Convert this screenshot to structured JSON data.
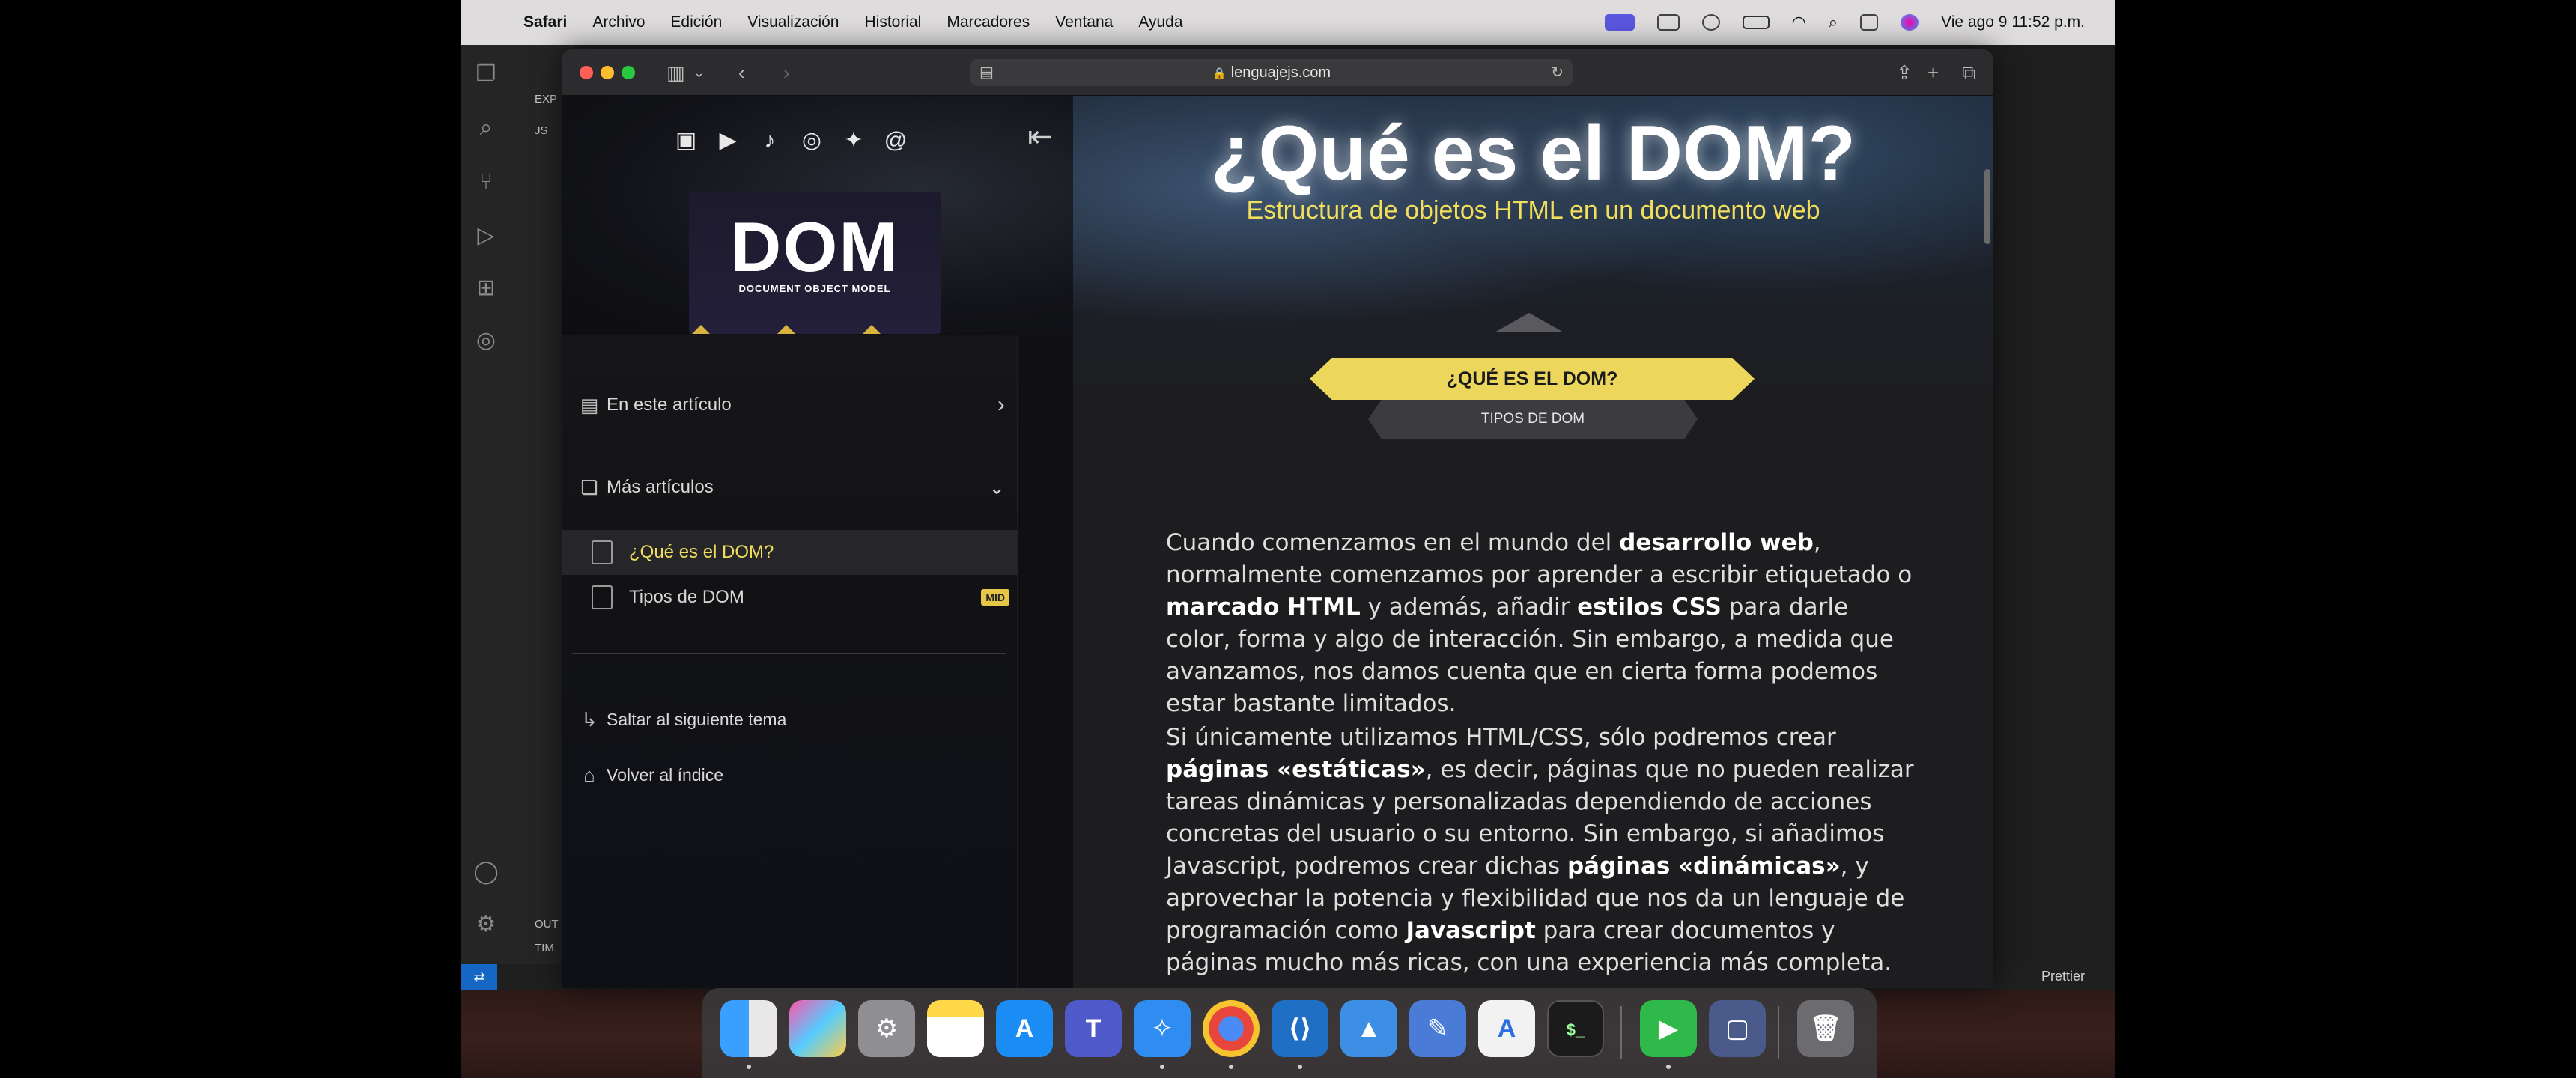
{
  "menubar": {
    "app": "Safari",
    "items": [
      "Archivo",
      "Edición",
      "Visualización",
      "Historial",
      "Marcadores",
      "Ventana",
      "Ayuda"
    ],
    "clock": "Vie ago 9  11:52 p.m."
  },
  "browser": {
    "url": "lenguajejs.com"
  },
  "sidebar": {
    "cover_title": "DOM",
    "cover_subtitle": "DOCUMENT OBJECT MODEL",
    "in_article": "En este artículo",
    "more_articles": "Más artículos",
    "articles": [
      {
        "label": "¿Qué es el DOM?",
        "active": true
      },
      {
        "label": "Tipos de DOM",
        "badge": "MID"
      }
    ],
    "skip_topic": "Saltar al siguiente tema",
    "back_index": "Volver al índice"
  },
  "article": {
    "title": "¿Qué es el DOM?",
    "subtitle": "Estructura de objetos HTML en un documento web",
    "nav_current": "¿QUÉ ES EL DOM?",
    "nav_next": "TIPOS DE DOM",
    "p1": {
      "t1": "Cuando comenzamos en el mundo del ",
      "b1": "desarrollo web",
      "t2": ", normalmente comenzamos por aprender a escribir etiquetado o ",
      "b2": "marcado HTML",
      "t3": " y además, añadir ",
      "b3": "estilos CSS",
      "t4": " para darle color, forma y algo de interacción. Sin embargo, a medida que avanzamos, nos damos cuenta que en cierta forma podemos estar bastante limitados."
    },
    "p2": {
      "t1": "Si únicamente utilizamos HTML/CSS, sólo podremos crear ",
      "b1": "páginas «estáticas»",
      "t2": ", es decir, páginas que no pueden realizar tareas dinámicas y personalizadas dependiendo de acciones concretas del usuario o su entorno. Sin embargo, si añadimos Javascript, podremos crear dichas ",
      "b2": "páginas «dinámicas»",
      "t3": ", y aprovechar la potencia y flexibilidad que nos da un lenguaje de programación como ",
      "b3": "Javascript",
      "t4": " para crear documentos y páginas mucho más ricas, con una experiencia más completa."
    }
  },
  "vscode": {
    "explorer_label": "EXP",
    "js_label": "JS",
    "outline_label": "OUT",
    "timeline_label": "TIM",
    "status_item": "Prettier"
  }
}
